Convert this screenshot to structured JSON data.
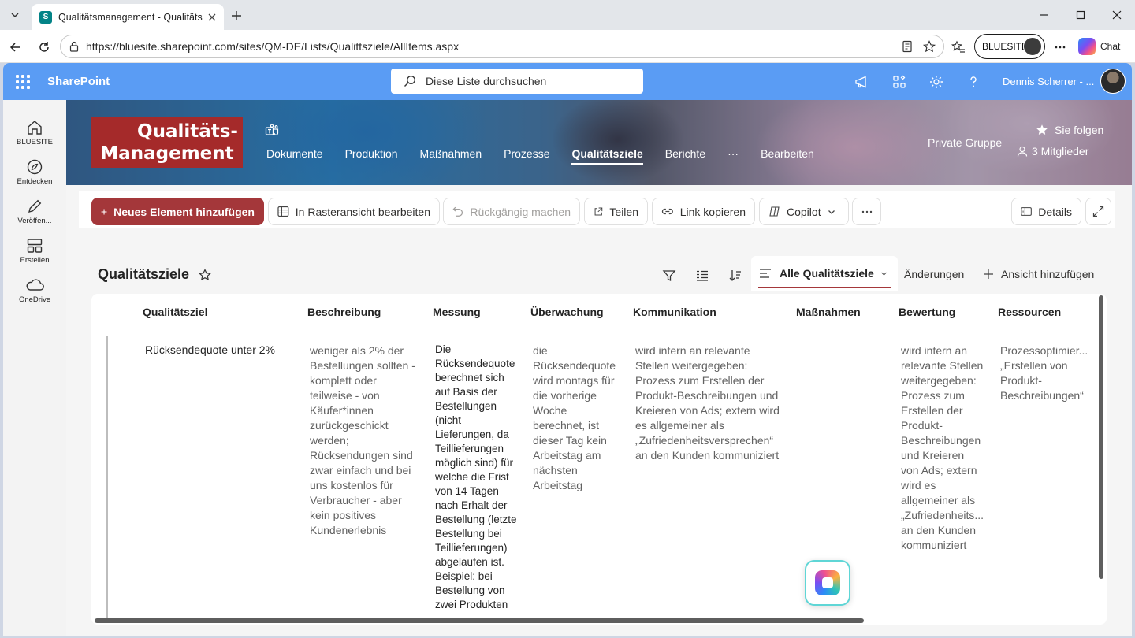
{
  "browser": {
    "tab_title": "Qualitätsmanagement - Qualitätsziele",
    "tab_favicon": "S",
    "url": "https://bluesite.sharepoint.com/sites/QM-DE/Lists/Qualittsziele/AllItems.aspx",
    "profile_label": "BLUESITE",
    "chat_label": "Chat"
  },
  "suite": {
    "brand": "SharePoint",
    "search_placeholder": "Diese Liste durchsuchen",
    "user_name": "Dennis Scherrer - ..."
  },
  "appbar": [
    {
      "label": "BLUESITE",
      "icon": "home-icon"
    },
    {
      "label": "Entdecken",
      "icon": "compass-icon"
    },
    {
      "label": "Veröffen...",
      "icon": "pen-icon"
    },
    {
      "label": "Erstellen",
      "icon": "create-icon"
    },
    {
      "label": "OneDrive",
      "icon": "cloud-icon"
    }
  ],
  "site": {
    "logo_line1": "Qualitäts-",
    "logo_line2": "Management",
    "nav": [
      "Dokumente",
      "Produktion",
      "Maßnahmen",
      "Prozesse",
      "Qualitätsziele",
      "Berichte",
      "···",
      "Bearbeiten"
    ],
    "active_nav": "Qualitätsziele",
    "privacy": "Private Gruppe",
    "follow": "Sie folgen",
    "members": "3 Mitglieder"
  },
  "commands": {
    "new_item": "Neues Element hinzufügen",
    "grid_edit": "In Rasteransicht bearbeiten",
    "undo": "Rückgängig machen",
    "share": "Teilen",
    "copy_link": "Link kopieren",
    "copilot": "Copilot",
    "details": "Details"
  },
  "list": {
    "title": "Qualitätsziele",
    "active_view": "Alle Qualitätsziele",
    "changes_view": "Änderungen",
    "add_view": "Ansicht hinzufügen",
    "columns": [
      "Qualitätsziel",
      "Beschreibung",
      "Messung",
      "Überwachung",
      "Kommunikation",
      "Maßnahmen",
      "Bewertung",
      "Ressourcen"
    ],
    "row": {
      "ziel": "Rücksendequote unter 2%",
      "beschreibung": [
        "weniger als 2% der",
        "Bestellungen sollten -",
        "komplett oder",
        "teilweise - von",
        "Käufer*innen",
        "zurückgeschickt",
        "werden;",
        "Rücksendungen sind",
        "zwar einfach und bei",
        "uns kostenlos für",
        "Verbraucher - aber",
        "kein positives",
        "Kundenerlebnis"
      ],
      "messung": [
        "Die",
        "Rücksendequote",
        "berechnet sich",
        "auf Basis der",
        "Bestellungen",
        "(nicht",
        "Lieferungen, da",
        "Teillieferungen",
        "möglich sind) für",
        "welche die Frist",
        "von 14 Tagen",
        "nach Erhalt der",
        "Bestellung (letzte",
        "Bestellung bei",
        "Teillieferungen)",
        "abgelaufen ist.",
        "Beispiel: bei",
        "Bestellung von",
        "zwei Produkten"
      ],
      "ueberwachung": [
        "die",
        "Rücksendequote",
        "wird montags für",
        "die vorherige",
        "Woche",
        "berechnet, ist",
        "dieser Tag kein",
        "Arbeitstag am",
        "nächsten",
        "Arbeitstag"
      ],
      "kommunikation": [
        "wird intern an relevante",
        "Stellen weitergegeben:",
        "Prozess zum Erstellen der",
        "Produkt-Beschreibungen und",
        "Kreieren von Ads; extern wird",
        "es allgemeiner als",
        "„Zufriedenheitsversprechen“",
        "an den Kunden kommuniziert"
      ],
      "massnahmen": [],
      "bewertung": [
        "wird intern an",
        "relevante Stellen",
        "weitergegeben:",
        "Prozess zum",
        "Erstellen der",
        "Produkt-",
        "Beschreibungen",
        "und Kreieren",
        "von Ads; extern",
        "wird es",
        "allgemeiner als",
        "„Zufriedenheits...",
        "an den Kunden",
        "kommuniziert"
      ],
      "ressourcen": [
        "Prozessoptimier...",
        "„Erstellen von",
        "Produkt-",
        "Beschreibungen“"
      ]
    }
  },
  "colors": {
    "suite_bar": "#5a9cf4",
    "accent": "#a4373a",
    "logo_red": "#a52a2a"
  }
}
